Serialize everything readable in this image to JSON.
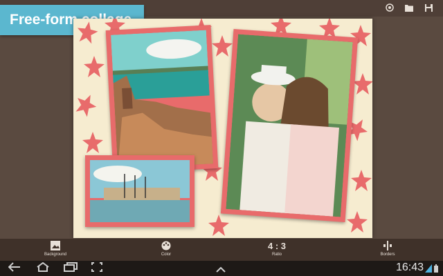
{
  "banner": {
    "title": "Free-form collage"
  },
  "toolbar": {
    "tools": [
      {
        "label": "Background",
        "icon": "background-icon"
      },
      {
        "label": "Color",
        "icon": "palette-icon"
      },
      {
        "label": "Ratio",
        "value": "4 : 3",
        "icon": "ratio-icon"
      },
      {
        "label": "Borders",
        "icon": "borders-icon"
      }
    ]
  },
  "top_actions": [
    "shutter-icon",
    "folder-icon",
    "save-icon"
  ],
  "status": {
    "time": "16:43"
  },
  "colors": {
    "banner": "#5bb7cf",
    "frame": "#e86b6b",
    "canvas": "#f6ecd0"
  }
}
